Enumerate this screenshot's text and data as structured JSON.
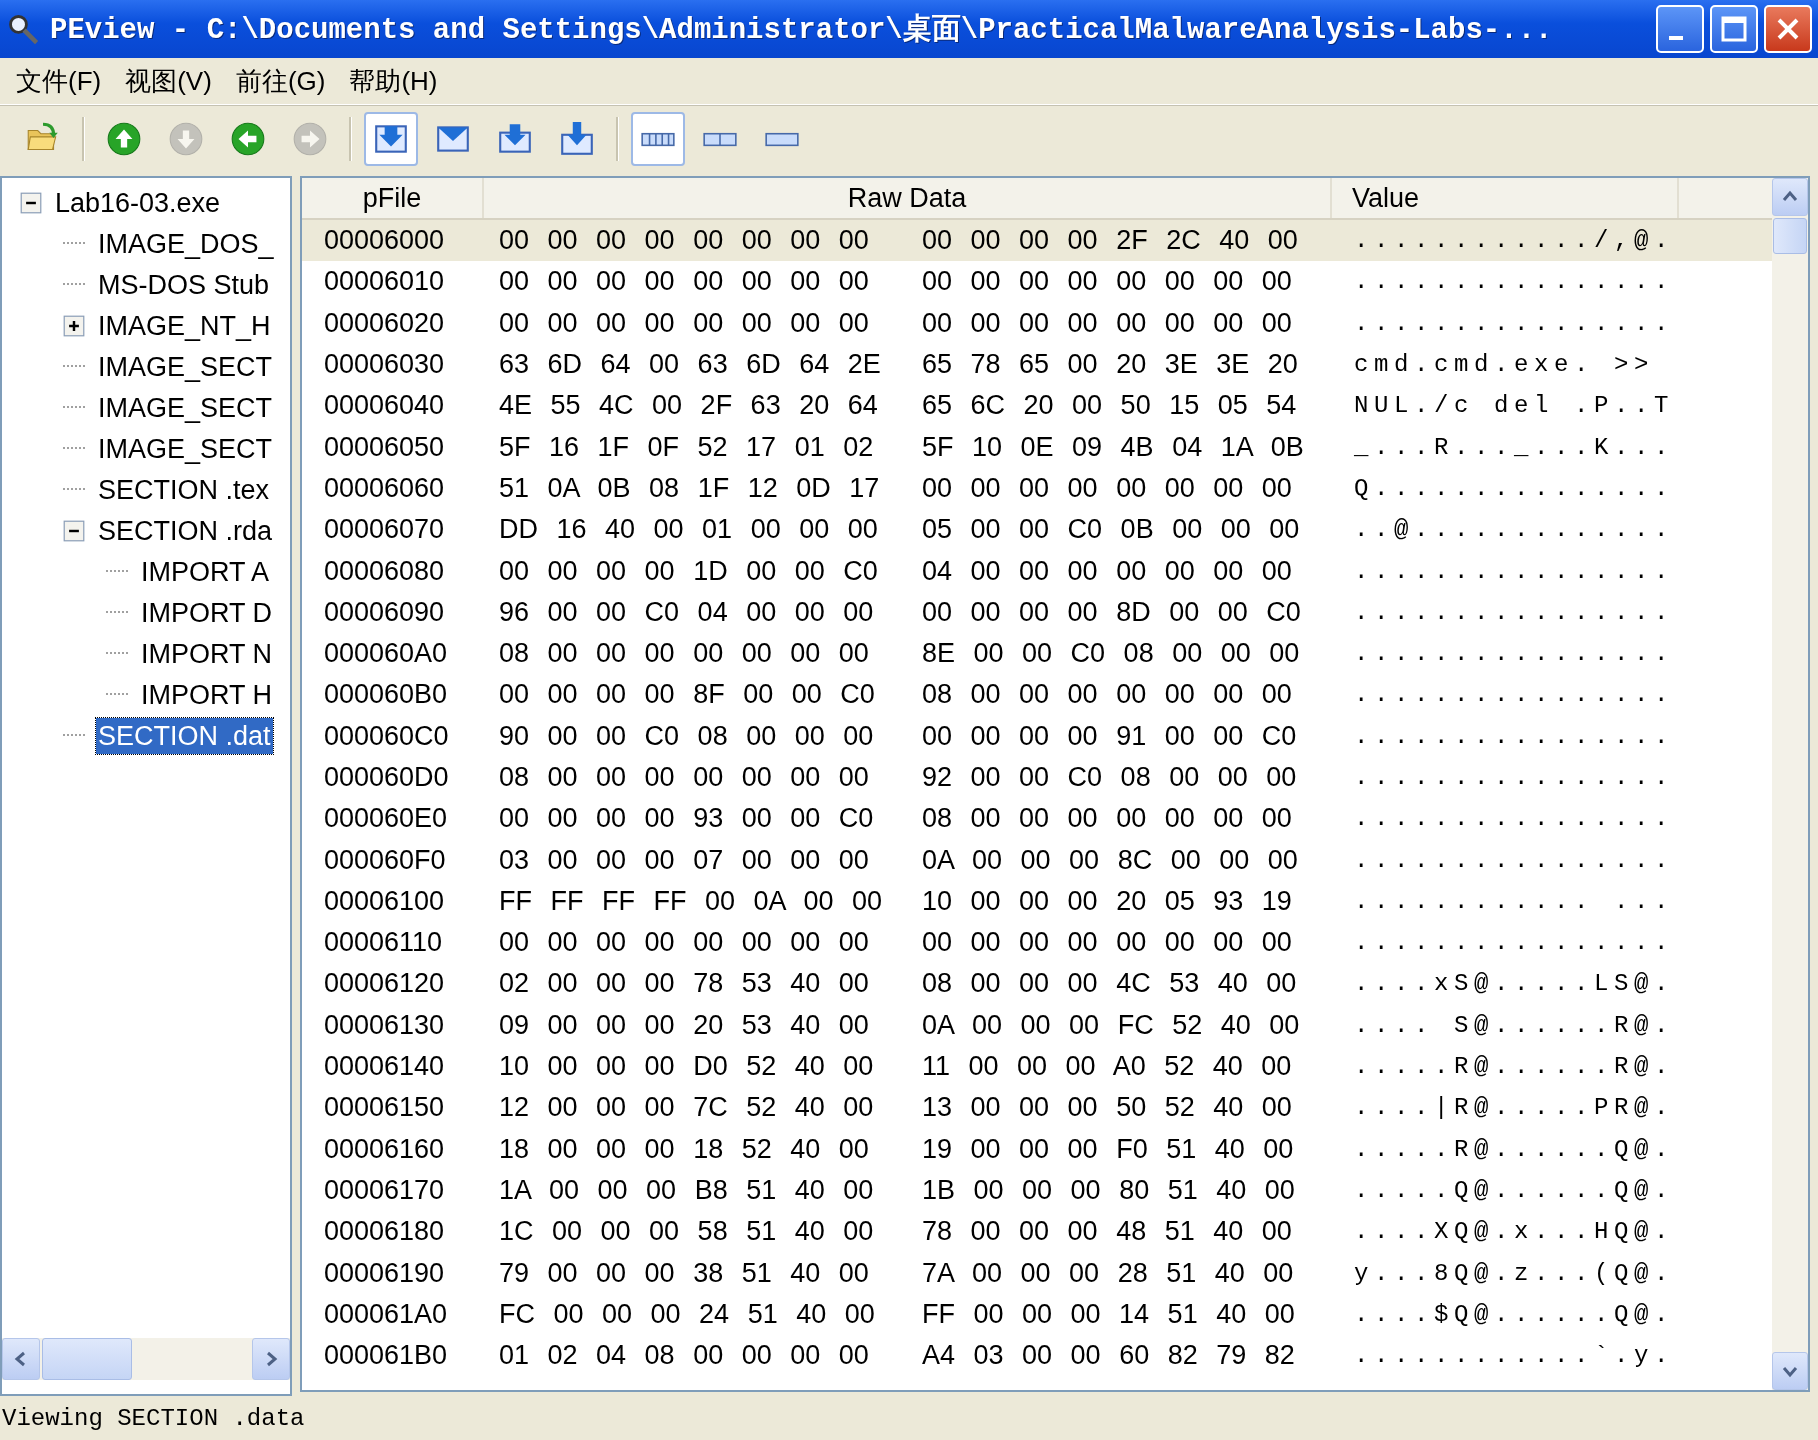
{
  "window": {
    "title": "PEview - C:\\Documents and Settings\\Administrator\\桌面\\PracticalMalwareAnalysis-Labs-..."
  },
  "menu": [
    "文件(F)",
    "视图(V)",
    "前往(G)",
    "帮助(H)"
  ],
  "toolbar": [
    {
      "kind": "open",
      "disabled": false,
      "pressed": false
    },
    {
      "kind": "separator"
    },
    {
      "kind": "up",
      "disabled": false,
      "pressed": false
    },
    {
      "kind": "down",
      "disabled": true,
      "pressed": false
    },
    {
      "kind": "back",
      "disabled": false,
      "pressed": false
    },
    {
      "kind": "forward",
      "disabled": true,
      "pressed": false
    },
    {
      "kind": "separator"
    },
    {
      "kind": "section-a",
      "disabled": false,
      "pressed": true
    },
    {
      "kind": "section-b",
      "disabled": false,
      "pressed": false
    },
    {
      "kind": "section-c",
      "disabled": false,
      "pressed": false
    },
    {
      "kind": "section-d",
      "disabled": false,
      "pressed": false
    },
    {
      "kind": "separator"
    },
    {
      "kind": "view-a",
      "disabled": false,
      "pressed": true
    },
    {
      "kind": "view-b",
      "disabled": false,
      "pressed": false
    },
    {
      "kind": "view-c",
      "disabled": false,
      "pressed": false
    }
  ],
  "tree": [
    {
      "label": "Lab16-03.exe",
      "expanded": true,
      "selected": false,
      "children": [
        {
          "label": "IMAGE_DOS_",
          "selected": false
        },
        {
          "label": "MS-DOS Stub",
          "selected": false
        },
        {
          "label": "IMAGE_NT_H",
          "expanded": false,
          "selected": false
        },
        {
          "label": "IMAGE_SECT",
          "selected": false
        },
        {
          "label": "IMAGE_SECT",
          "selected": false
        },
        {
          "label": "IMAGE_SECT",
          "selected": false
        },
        {
          "label": "SECTION .tex",
          "selected": false
        },
        {
          "label": "SECTION .rda",
          "expanded": true,
          "selected": false,
          "children": [
            {
              "label": "IMPORT A",
              "selected": false
            },
            {
              "label": "IMPORT D",
              "selected": false
            },
            {
              "label": "IMPORT N",
              "selected": false
            },
            {
              "label": "IMPORT H",
              "selected": false
            }
          ]
        },
        {
          "label": "SECTION .dat",
          "selected": true
        }
      ]
    }
  ],
  "table": {
    "columns": [
      "pFile",
      "Raw Data",
      "Value"
    ],
    "rows": [
      {
        "pfile": "00006000",
        "raw": [
          "00 00 00 00 00 00 00 00",
          "00 00 00 00 2F 2C 40 00"
        ],
        "value": "............/,@.",
        "selected": true
      },
      {
        "pfile": "00006010",
        "raw": [
          "00 00 00 00 00 00 00 00",
          "00 00 00 00 00 00 00 00"
        ],
        "value": "................",
        "selected": false
      },
      {
        "pfile": "00006020",
        "raw": [
          "00 00 00 00 00 00 00 00",
          "00 00 00 00 00 00 00 00"
        ],
        "value": "................",
        "selected": false
      },
      {
        "pfile": "00006030",
        "raw": [
          "63 6D 64 00 63 6D 64 2E",
          "65 78 65 00 20 3E 3E 20"
        ],
        "value": "cmd.cmd.exe. >> ",
        "selected": false
      },
      {
        "pfile": "00006040",
        "raw": [
          "4E 55 4C 00 2F 63 20 64",
          "65 6C 20 00 50 15 05 54"
        ],
        "value": "NUL./c del .P..T",
        "selected": false
      },
      {
        "pfile": "00006050",
        "raw": [
          "5F 16 1F 0F 52 17 01 02",
          "5F 10 0E 09 4B 04 1A 0B"
        ],
        "value": "_...R..._...K...",
        "selected": false
      },
      {
        "pfile": "00006060",
        "raw": [
          "51 0A 0B 08 1F 12 0D 17",
          "00 00 00 00 00 00 00 00"
        ],
        "value": "Q...............",
        "selected": false
      },
      {
        "pfile": "00006070",
        "raw": [
          "DD 16 40 00 01 00 00 00",
          "05 00 00 C0 0B 00 00 00"
        ],
        "value": "..@.............",
        "selected": false
      },
      {
        "pfile": "00006080",
        "raw": [
          "00 00 00 00 1D 00 00 C0",
          "04 00 00 00 00 00 00 00"
        ],
        "value": "................",
        "selected": false
      },
      {
        "pfile": "00006090",
        "raw": [
          "96 00 00 C0 04 00 00 00",
          "00 00 00 00 8D 00 00 C0"
        ],
        "value": "................",
        "selected": false
      },
      {
        "pfile": "000060A0",
        "raw": [
          "08 00 00 00 00 00 00 00",
          "8E 00 00 C0 08 00 00 00"
        ],
        "value": "................",
        "selected": false
      },
      {
        "pfile": "000060B0",
        "raw": [
          "00 00 00 00 8F 00 00 C0",
          "08 00 00 00 00 00 00 00"
        ],
        "value": "................",
        "selected": false
      },
      {
        "pfile": "000060C0",
        "raw": [
          "90 00 00 C0 08 00 00 00",
          "00 00 00 00 91 00 00 C0"
        ],
        "value": "................",
        "selected": false
      },
      {
        "pfile": "000060D0",
        "raw": [
          "08 00 00 00 00 00 00 00",
          "92 00 00 C0 08 00 00 00"
        ],
        "value": "................",
        "selected": false
      },
      {
        "pfile": "000060E0",
        "raw": [
          "00 00 00 00 93 00 00 C0",
          "08 00 00 00 00 00 00 00"
        ],
        "value": "................",
        "selected": false
      },
      {
        "pfile": "000060F0",
        "raw": [
          "03 00 00 00 07 00 00 00",
          "0A 00 00 00 8C 00 00 00"
        ],
        "value": "................",
        "selected": false
      },
      {
        "pfile": "00006100",
        "raw": [
          "FF FF FF FF 00 0A 00 00",
          "10 00 00 00 20 05 93 19"
        ],
        "value": "............ ...",
        "selected": false
      },
      {
        "pfile": "00006110",
        "raw": [
          "00 00 00 00 00 00 00 00",
          "00 00 00 00 00 00 00 00"
        ],
        "value": "................",
        "selected": false
      },
      {
        "pfile": "00006120",
        "raw": [
          "02 00 00 00 78 53 40 00",
          "08 00 00 00 4C 53 40 00"
        ],
        "value": "....xS@.....LS@.",
        "selected": false
      },
      {
        "pfile": "00006130",
        "raw": [
          "09 00 00 00 20 53 40 00",
          "0A 00 00 00 FC 52 40 00"
        ],
        "value": ".... S@......R@.",
        "selected": false
      },
      {
        "pfile": "00006140",
        "raw": [
          "10 00 00 00 D0 52 40 00",
          "11 00 00 00 A0 52 40 00"
        ],
        "value": ".....R@......R@.",
        "selected": false
      },
      {
        "pfile": "00006150",
        "raw": [
          "12 00 00 00 7C 52 40 00",
          "13 00 00 00 50 52 40 00"
        ],
        "value": "....|R@.....PR@.",
        "selected": false
      },
      {
        "pfile": "00006160",
        "raw": [
          "18 00 00 00 18 52 40 00",
          "19 00 00 00 F0 51 40 00"
        ],
        "value": ".....R@......Q@.",
        "selected": false
      },
      {
        "pfile": "00006170",
        "raw": [
          "1A 00 00 00 B8 51 40 00",
          "1B 00 00 00 80 51 40 00"
        ],
        "value": ".....Q@......Q@.",
        "selected": false
      },
      {
        "pfile": "00006180",
        "raw": [
          "1C 00 00 00 58 51 40 00",
          "78 00 00 00 48 51 40 00"
        ],
        "value": "....XQ@.x...HQ@.",
        "selected": false
      },
      {
        "pfile": "00006190",
        "raw": [
          "79 00 00 00 38 51 40 00",
          "7A 00 00 00 28 51 40 00"
        ],
        "value": "y...8Q@.z...(Q@.",
        "selected": false
      },
      {
        "pfile": "000061A0",
        "raw": [
          "FC 00 00 00 24 51 40 00",
          "FF 00 00 00 14 51 40 00"
        ],
        "value": "....$Q@......Q@.",
        "selected": false
      },
      {
        "pfile": "000061B0",
        "raw": [
          "01 02 04 08 00 00 00 00",
          "A4 03 00 00 60 82 79 82"
        ],
        "value": "............`.y.",
        "selected": false
      }
    ]
  },
  "status_bar": "Viewing SECTION .data"
}
